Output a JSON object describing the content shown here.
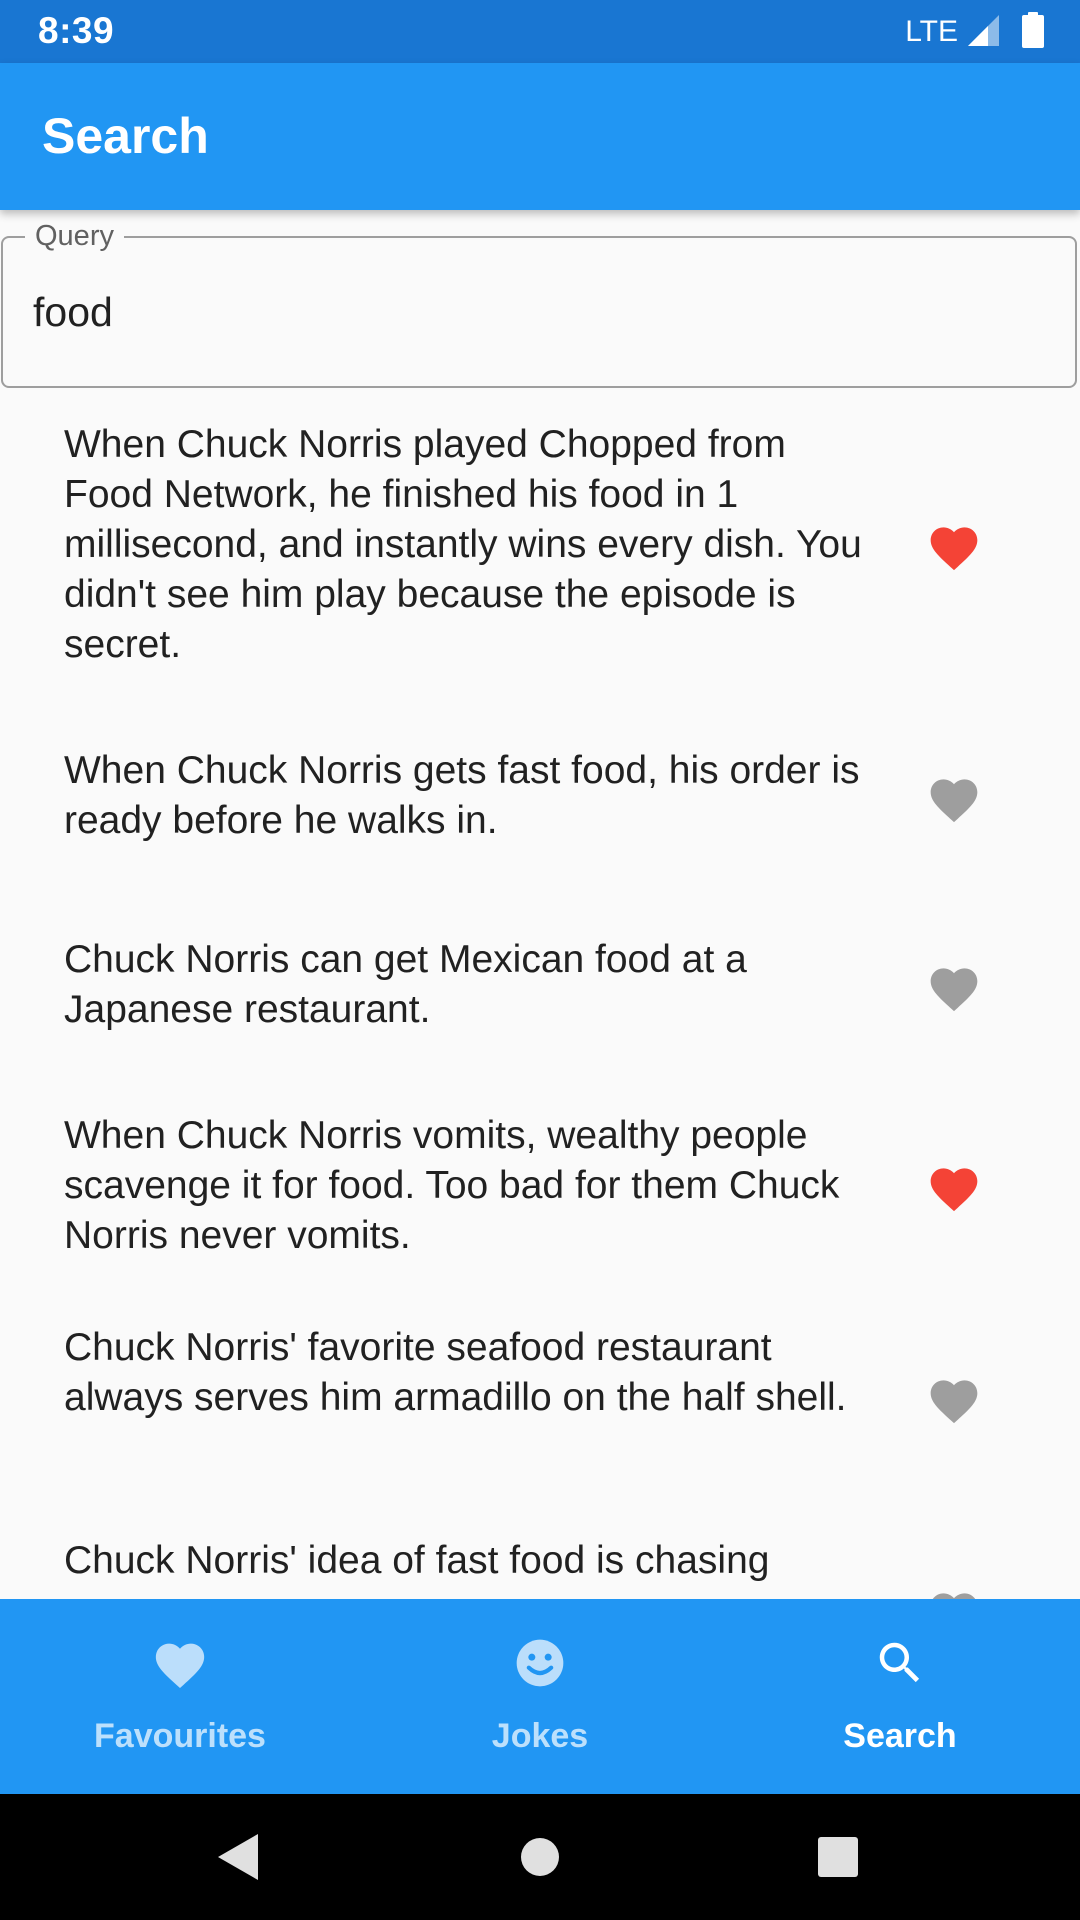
{
  "status_bar": {
    "time": "8:39",
    "network": "LTE"
  },
  "app_bar": {
    "title": "Search"
  },
  "search": {
    "label": "Query",
    "value": "food"
  },
  "jokes": [
    {
      "text": "When Chuck Norris played Chopped from Food Network, he finished his food in 1 millisecond, and instantly wins every dish. You didn't see him play because the episode is secret.",
      "favourite": true
    },
    {
      "text": "When Chuck Norris gets fast food, his order is ready before he walks in.",
      "favourite": false
    },
    {
      "text": "Chuck Norris can get Mexican food at a Japanese restaurant.",
      "favourite": false
    },
    {
      "text": "When Chuck Norris vomits, wealthy people scavenge it for food. Too bad for them Chuck Norris never vomits.",
      "favourite": true
    },
    {
      "text": "Chuck Norris' favorite seafood restaurant always serves him armadillo on the half shell.",
      "favourite": false
    },
    {
      "text": "Chuck Norris' idea of fast food is chasing",
      "favourite": false
    }
  ],
  "bottom_nav": {
    "items": [
      {
        "label": "Favourites",
        "icon": "heart-icon",
        "active": false
      },
      {
        "label": "Jokes",
        "icon": "smiley-icon",
        "active": false
      },
      {
        "label": "Search",
        "icon": "search-icon",
        "active": true
      }
    ]
  },
  "colors": {
    "status_bar": "#1976D2",
    "primary": "#2196F3",
    "favourite_active": "#F44336",
    "favourite_inactive": "#9E9E9E",
    "nav_inactive_icon": "#BBDEFB",
    "background": "#FAFAFA"
  }
}
